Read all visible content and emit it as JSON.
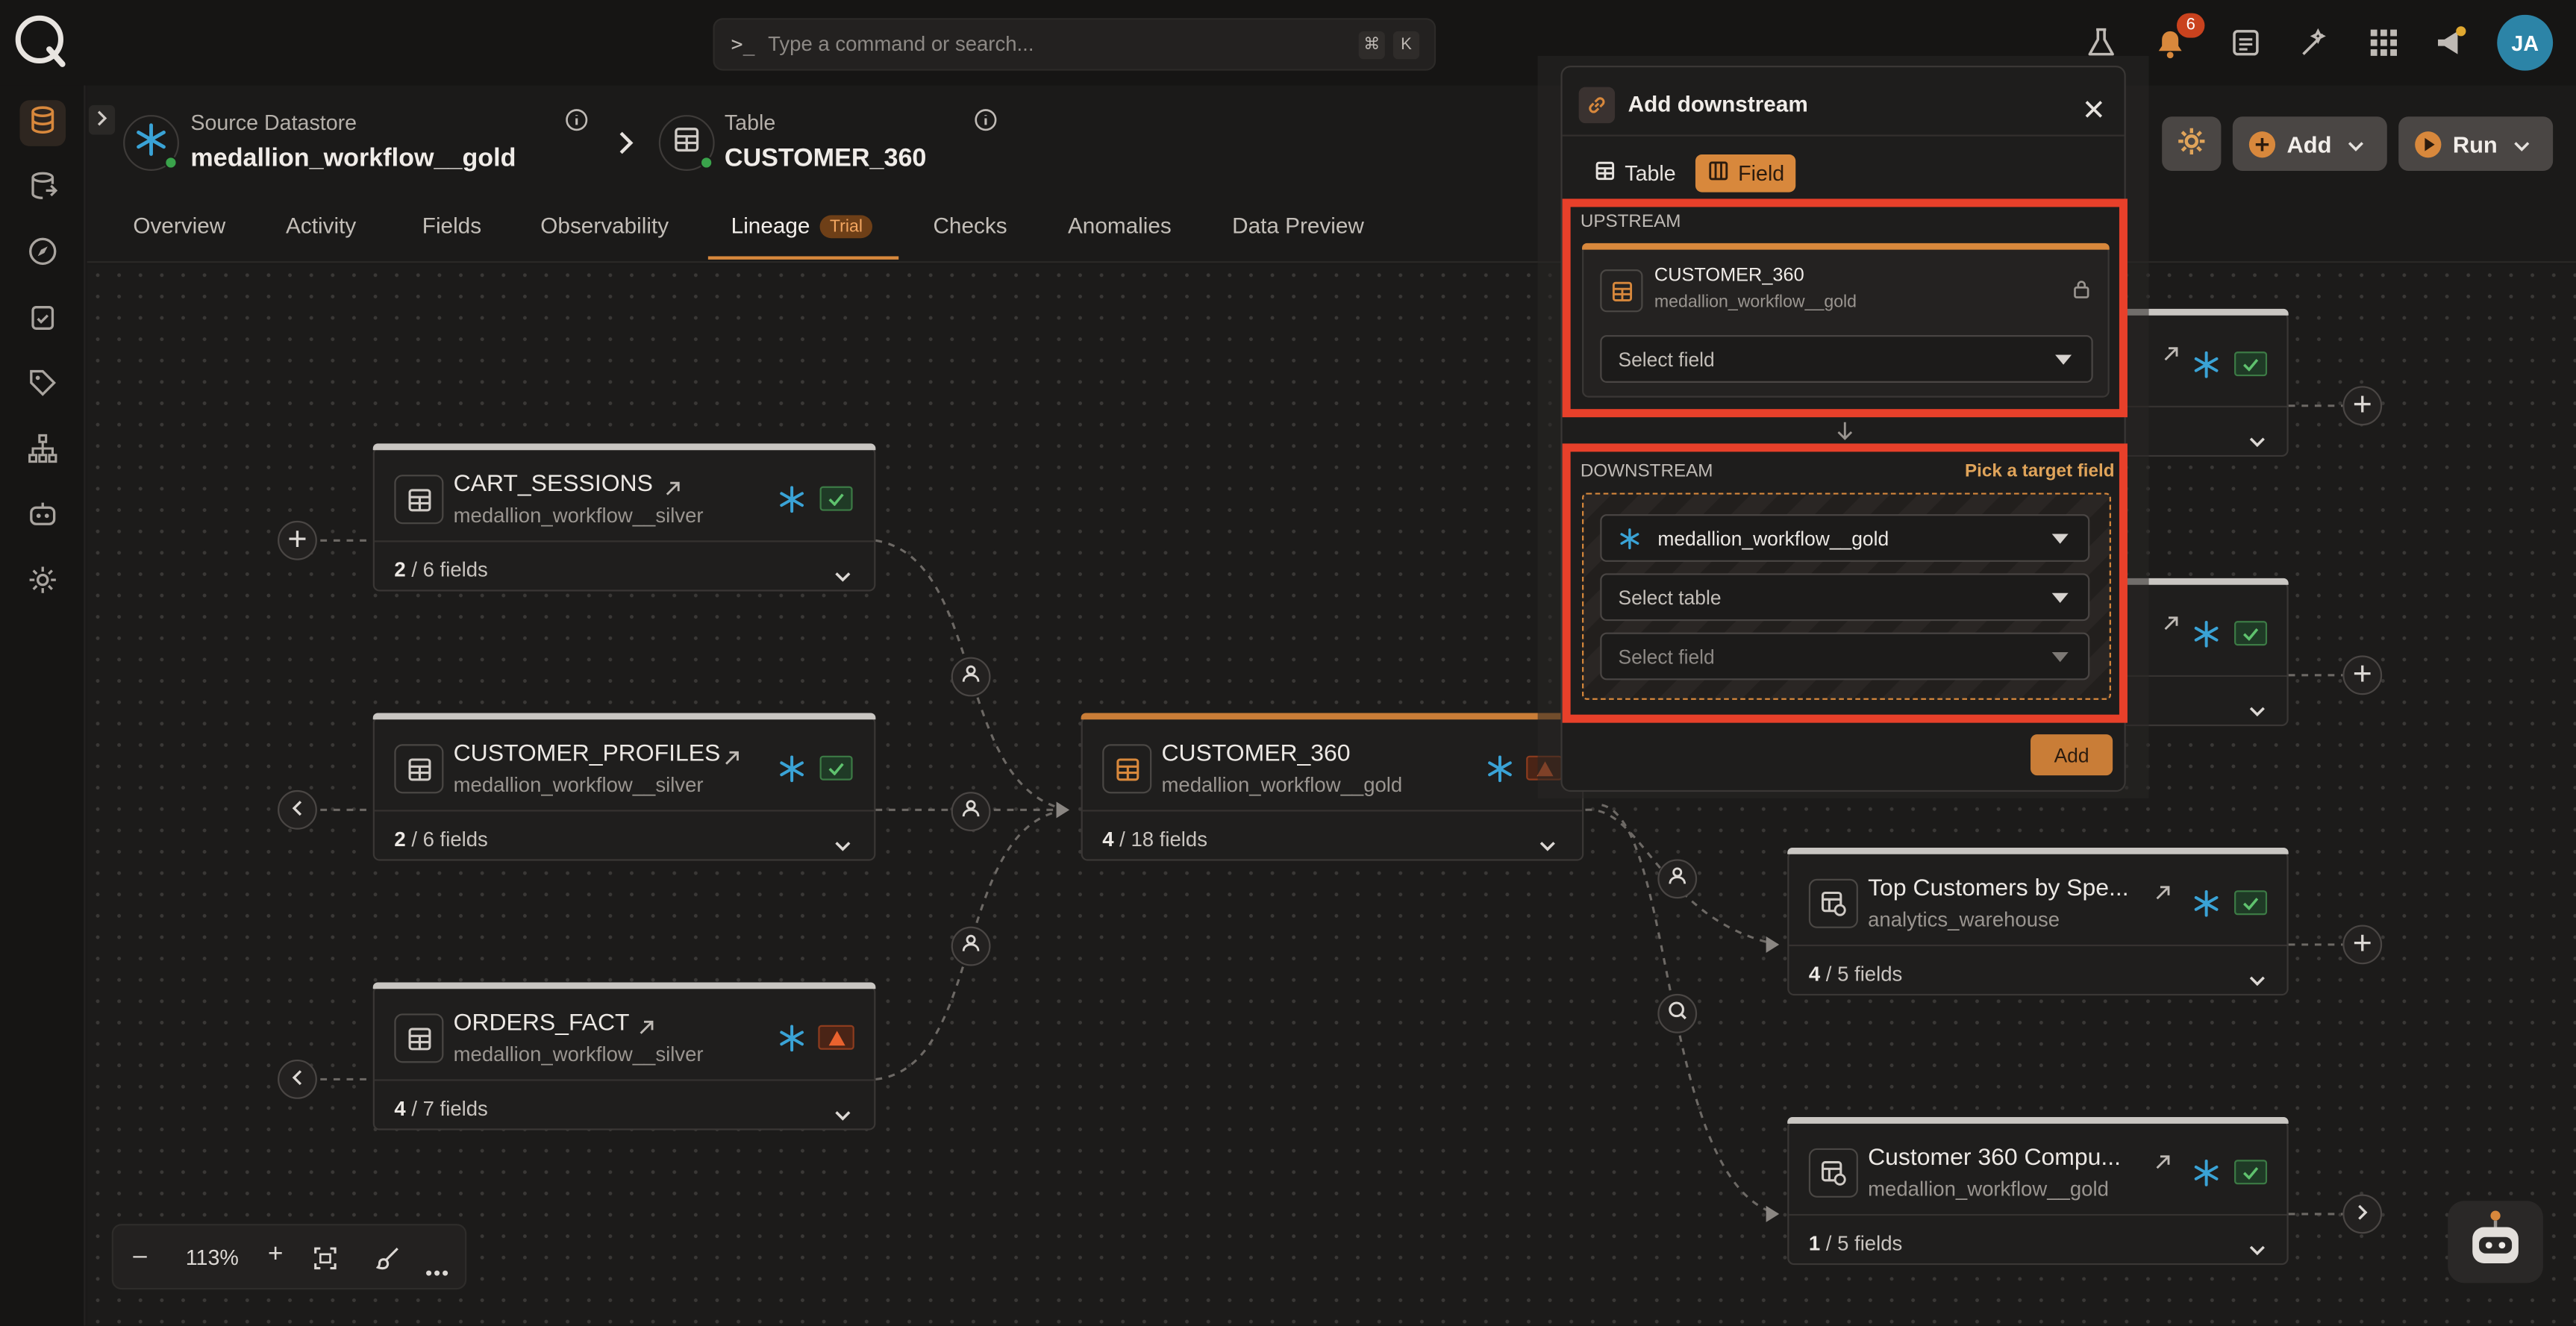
{
  "search": {
    "placeholder": "Type a command or search...",
    "shortcut_key1": "⌘",
    "shortcut_key2": "K"
  },
  "notifications": {
    "count": "6"
  },
  "user": {
    "initials": "JA"
  },
  "breadcrumb": {
    "source_label": "Source Datastore",
    "source_value": "medallion_workflow__gold",
    "table_label": "Table",
    "table_value": "CUSTOMER_360"
  },
  "header_buttons": {
    "add": "Add",
    "run": "Run"
  },
  "tabs": [
    {
      "label": "Overview"
    },
    {
      "label": "Activity"
    },
    {
      "label": "Fields"
    },
    {
      "label": "Observability"
    },
    {
      "label": "Lineage",
      "badge": "Trial"
    },
    {
      "label": "Checks"
    },
    {
      "label": "Anomalies"
    },
    {
      "label": "Data Preview"
    }
  ],
  "nodes": {
    "cart_sessions": {
      "name": "CART_SESSIONS",
      "sub": "medallion_workflow__silver",
      "fields_a": "2",
      "fields_b": " / 6 fields"
    },
    "customer_profiles": {
      "name": "CUSTOMER_PROFILES",
      "sub": "medallion_workflow__silver",
      "fields_a": "2",
      "fields_b": " / 6 fields"
    },
    "orders_fact": {
      "name": "ORDERS_FACT",
      "sub": "medallion_workflow__silver",
      "fields_a": "4",
      "fields_b": " / 7 fields"
    },
    "customer_360": {
      "name": "CUSTOMER_360",
      "sub": "medallion_workflow__gold",
      "fields_a": "4",
      "fields_b": " / 18 fields"
    },
    "top_customers": {
      "name": "Top Customers by Spe...",
      "sub": "analytics_warehouse",
      "fields_a": "4",
      "fields_b": " / 5 fields"
    },
    "customer_360_compu": {
      "name": "Customer 360 Compu...",
      "sub": "medallion_workflow__gold",
      "fields_a": "1",
      "fields_b": " / 5 fields"
    }
  },
  "zoom": {
    "level": "113%",
    "minus": "–",
    "plus": "+"
  },
  "panel": {
    "title": "Add downstream",
    "toggle_table": "Table",
    "toggle_field": "Field",
    "upstream_label": "UPSTREAM",
    "upstream_table": "CUSTOMER_360",
    "upstream_datastore": "medallion_workflow__gold",
    "upstream_select_field": "Select field",
    "downstream_label": "DOWNSTREAM",
    "downstream_hint": "Pick a target field",
    "downstream_datastore": "medallion_workflow__gold",
    "downstream_select_table": "Select table",
    "downstream_select_field": "Select field",
    "add_button": "Add"
  },
  "colors": {
    "accent": "#d8883c",
    "highlight": "#e8402a",
    "snowflake": "#3aa3d6",
    "ok": "#3c7b45",
    "warn": "#c9421e"
  }
}
